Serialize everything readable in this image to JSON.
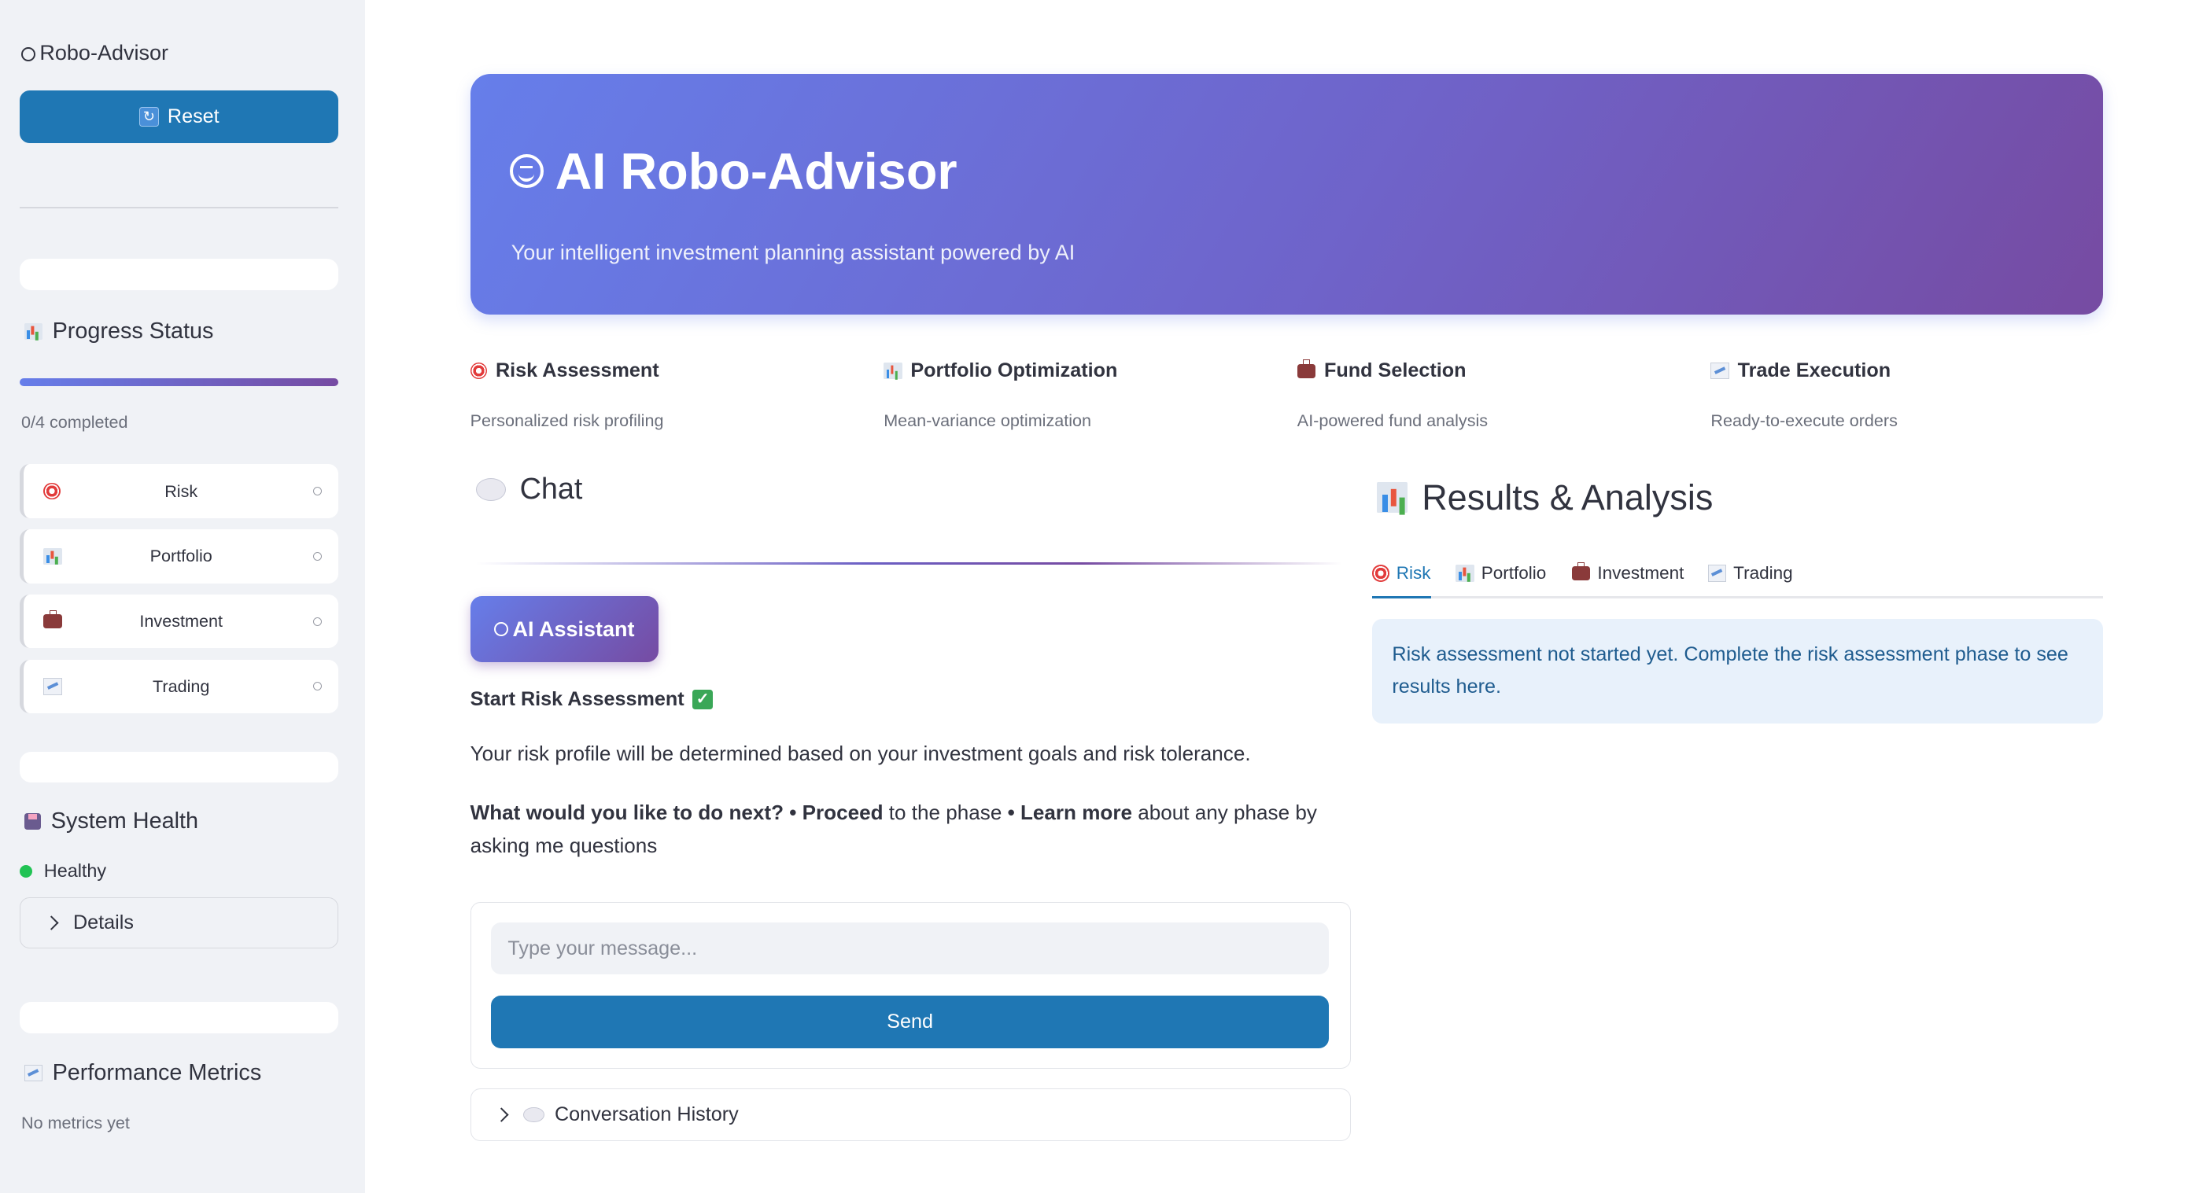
{
  "sidebar": {
    "title": "Robo-Advisor",
    "reset_label": "Reset",
    "progress": {
      "heading": "Progress Status",
      "completed_text": "0/4 completed",
      "fraction": 0
    },
    "phases": [
      {
        "label": "Risk",
        "icon": "target-icon"
      },
      {
        "label": "Portfolio",
        "icon": "chart-icon"
      },
      {
        "label": "Investment",
        "icon": "briefcase-icon"
      },
      {
        "label": "Trading",
        "icon": "trend-icon"
      }
    ],
    "system_health": {
      "heading": "System Health",
      "status": "Healthy",
      "status_color": "#21c354",
      "details_label": "Details"
    },
    "performance": {
      "heading": "Performance Metrics",
      "empty_text": "No metrics yet"
    }
  },
  "hero": {
    "title": "AI Robo-Advisor",
    "subtitle": "Your intelligent investment planning assistant powered by AI"
  },
  "features": [
    {
      "title": "Risk Assessment",
      "desc": "Personalized risk profiling",
      "icon": "target-icon"
    },
    {
      "title": "Portfolio Optimization",
      "desc": "Mean-variance optimization",
      "icon": "chart-icon"
    },
    {
      "title": "Fund Selection",
      "desc": "AI-powered fund analysis",
      "icon": "briefcase-icon"
    },
    {
      "title": "Trade Execution",
      "desc": "Ready-to-execute orders",
      "icon": "trend-icon"
    }
  ],
  "chat": {
    "heading": "Chat",
    "assistant_badge": "AI Assistant",
    "message": {
      "title": "Start Risk Assessment",
      "p1": "Your risk profile will be determined based on your investment goals and risk tolerance.",
      "p2_intro": "What would you like to do next?",
      "p2_bullet1_bold": "• Proceed",
      "p2_bullet1_rest": " to the phase ",
      "p2_bullet2_bold": "• Learn more",
      "p2_bullet2_rest": " about any phase by asking me questions"
    },
    "input_placeholder": "Type your message...",
    "input_value": "",
    "send_label": "Send",
    "history_label": "Conversation History"
  },
  "results": {
    "heading": "Results & Analysis",
    "tabs": [
      {
        "label": "Risk",
        "icon": "target-icon",
        "active": true
      },
      {
        "label": "Portfolio",
        "icon": "chart-icon",
        "active": false
      },
      {
        "label": "Investment",
        "icon": "briefcase-icon",
        "active": false
      },
      {
        "label": "Trading",
        "icon": "trend-icon",
        "active": false
      }
    ],
    "info_text": "Risk assessment not started yet. Complete the risk assessment phase to see results here."
  },
  "colors": {
    "accent": "#1f77b4",
    "gradient_start": "#667eea",
    "gradient_end": "#764ba2",
    "sidebar_bg": "#f0f2f6",
    "info_bg": "#e8f1fb"
  }
}
